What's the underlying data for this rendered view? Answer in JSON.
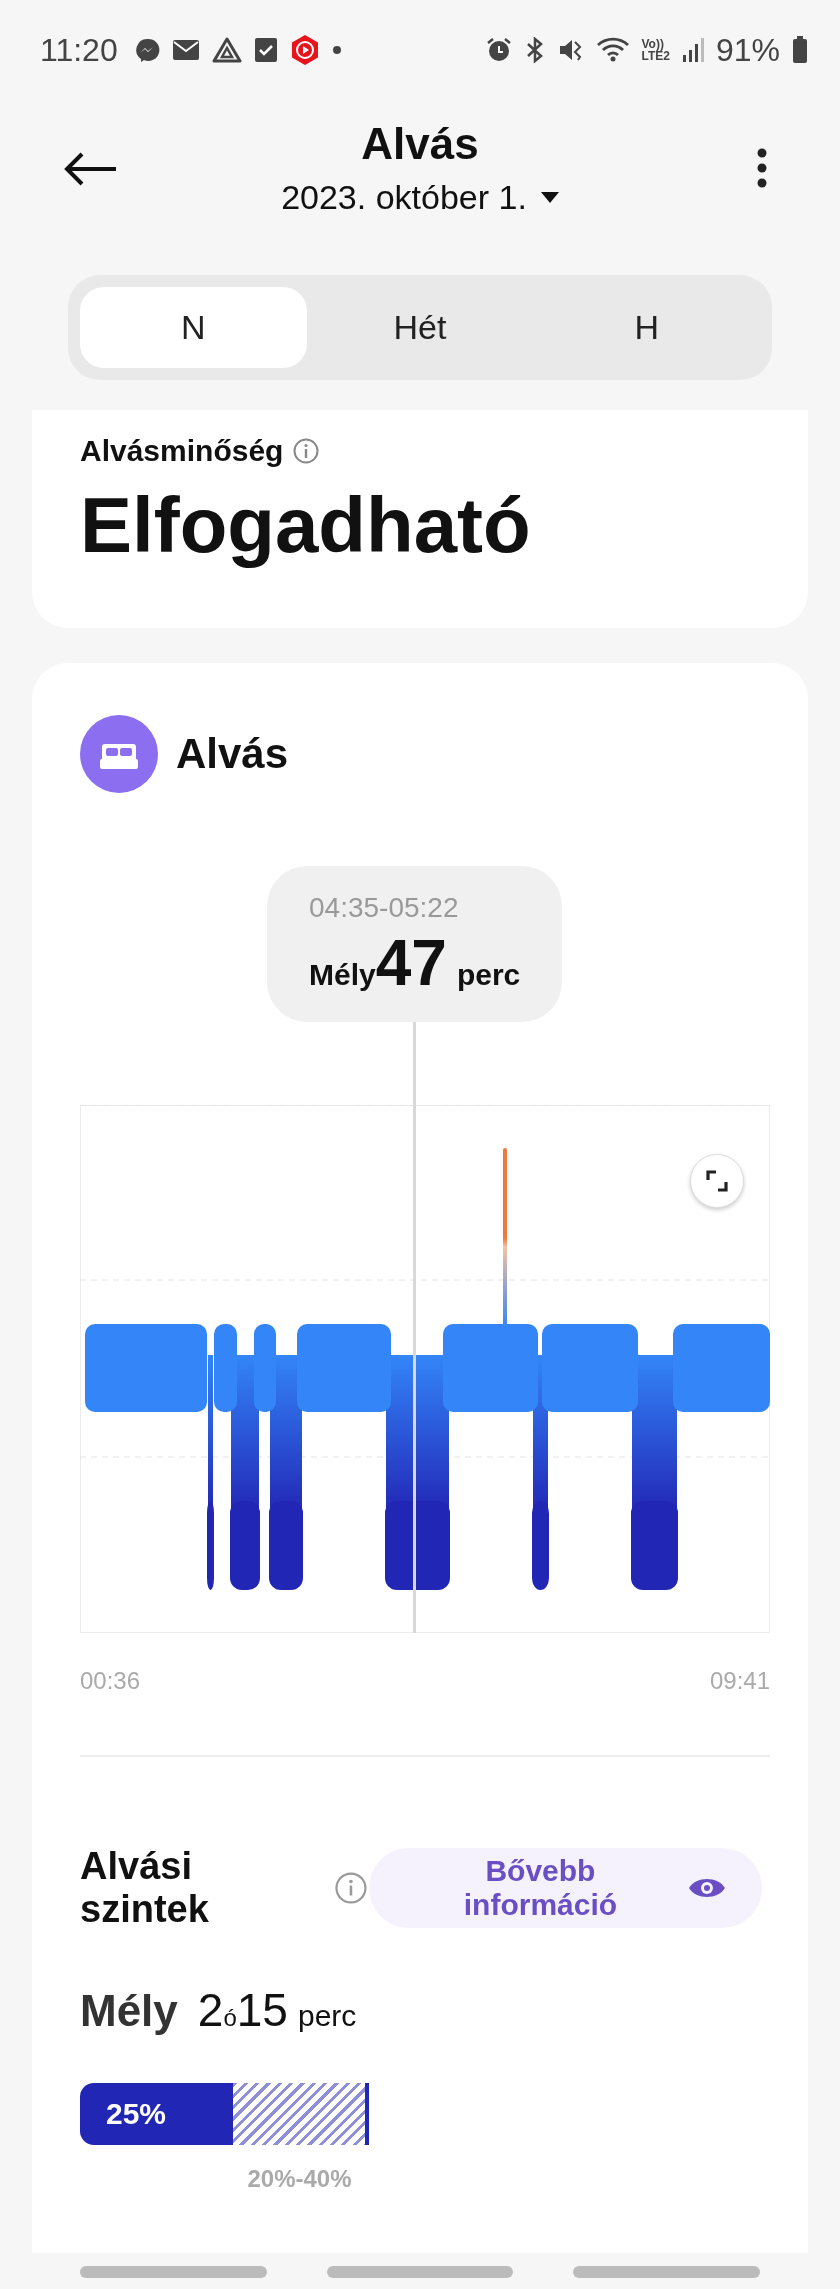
{
  "status_bar": {
    "time": "11:20",
    "network_top": "Vo))",
    "network_bottom": "LTE2",
    "battery": "91%"
  },
  "header": {
    "title": "Alvás",
    "date": "2023. október 1."
  },
  "tabs": [
    {
      "label": "N",
      "selected": true
    },
    {
      "label": "Hét",
      "selected": false
    },
    {
      "label": "H",
      "selected": false
    }
  ],
  "quality": {
    "label": "Alvásminőség",
    "value": "Elfogadható"
  },
  "sleep_card": {
    "title": "Alvás",
    "tooltip": {
      "time_range": "04:35-05:22",
      "stage": "Mély",
      "duration": "47",
      "unit": "perc"
    },
    "axis_start": "00:36",
    "axis_end": "09:41"
  },
  "levels": {
    "title": "Alvási szintek",
    "more_button": "Bővebb információ",
    "stage": {
      "name": "Mély",
      "hours": "2",
      "hours_unit": "ó",
      "minutes": "15",
      "minutes_unit": "perc",
      "percent": "25%",
      "range": "20%-40%"
    }
  }
}
